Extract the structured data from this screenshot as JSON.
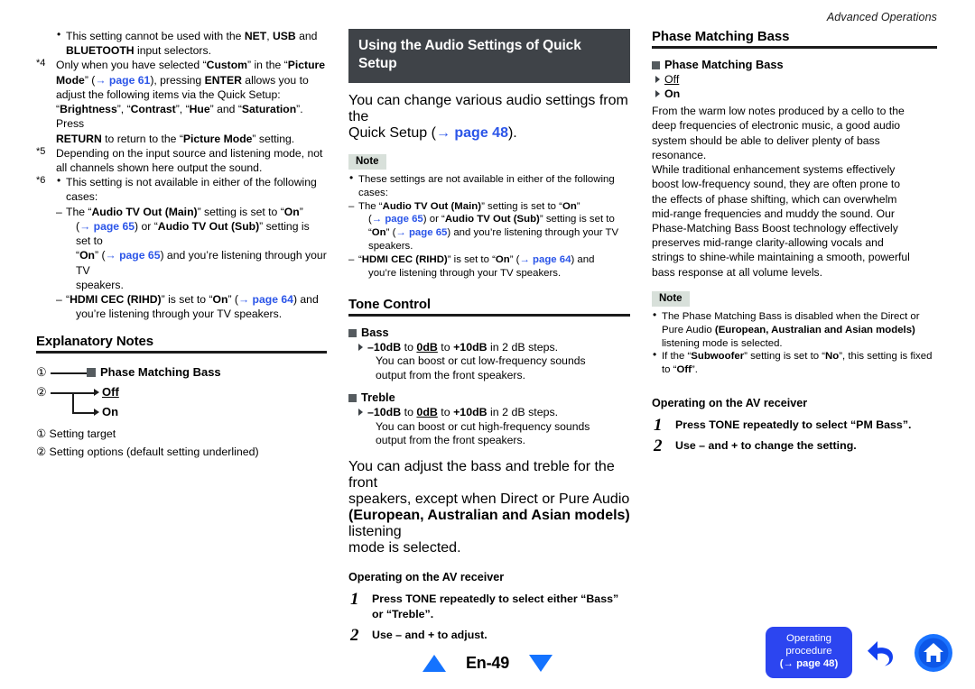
{
  "running_head": "Advanced Operations",
  "left_column": {
    "footnotes": [
      {
        "mark": "",
        "lines": [
          {
            "style": "bullet",
            "segments": [
              {
                "t": "This setting cannot be used with the ",
                "b": false
              },
              {
                "t": "NET",
                "b": true
              },
              {
                "t": ", ",
                "b": false
              },
              {
                "t": "USB",
                "b": true
              },
              {
                "t": " and",
                "b": false
              }
            ]
          },
          {
            "style": "cont1",
            "segments": [
              {
                "t": "BLUETOOTH",
                "b": true
              },
              {
                "t": " input selectors.",
                "b": false
              }
            ]
          }
        ]
      },
      {
        "mark": "*4",
        "lines": [
          {
            "style": "plain",
            "segments": [
              {
                "t": "Only when you have selected “",
                "b": false
              },
              {
                "t": "Custom",
                "b": true
              },
              {
                "t": "” in the “",
                "b": false
              },
              {
                "t": "Picture",
                "b": true
              }
            ]
          },
          {
            "style": "plain",
            "segments": [
              {
                "t": "Mode",
                "b": true
              },
              {
                "t": "” (",
                "b": false
              },
              {
                "t": "→ page 61",
                "link": true
              },
              {
                "t": "), pressing ",
                "b": false
              },
              {
                "t": "ENTER",
                "b": true
              },
              {
                "t": " allows you to",
                "b": false
              }
            ]
          },
          {
            "style": "plain",
            "segments": [
              {
                "t": "adjust the following items via the Quick Setup:",
                "b": false
              }
            ]
          },
          {
            "style": "plain",
            "segments": [
              {
                "t": "“",
                "b": false
              },
              {
                "t": "Brightness",
                "b": true
              },
              {
                "t": "”, “",
                "b": false
              },
              {
                "t": "Contrast",
                "b": true
              },
              {
                "t": "”, “",
                "b": false
              },
              {
                "t": "Hue",
                "b": true
              },
              {
                "t": "” and “",
                "b": false
              },
              {
                "t": "Saturation",
                "b": true
              },
              {
                "t": "”. Press",
                "b": false
              }
            ]
          },
          {
            "style": "plain",
            "segments": [
              {
                "t": "RETURN",
                "b": true
              },
              {
                "t": " to return to the “",
                "b": false
              },
              {
                "t": "Picture Mode",
                "b": true
              },
              {
                "t": "” setting.",
                "b": false
              }
            ]
          }
        ]
      },
      {
        "mark": "*5",
        "lines": [
          {
            "style": "plain",
            "segments": [
              {
                "t": "Depending on the input source and listening mode, not",
                "b": false
              }
            ]
          },
          {
            "style": "plain",
            "segments": [
              {
                "t": "all channels shown here output the sound.",
                "b": false
              }
            ]
          }
        ]
      },
      {
        "mark": "*6",
        "lines": [
          {
            "style": "bullet",
            "segments": [
              {
                "t": "This setting is not available in either of the following",
                "b": false
              }
            ]
          },
          {
            "style": "cont1",
            "segments": [
              {
                "t": "cases:",
                "b": false
              }
            ]
          },
          {
            "style": "dash",
            "segments": [
              {
                "t": "The “",
                "b": false
              },
              {
                "t": "Audio TV Out (Main)",
                "b": true
              },
              {
                "t": "” setting is set to “",
                "b": false
              },
              {
                "t": "On",
                "b": true
              },
              {
                "t": "”",
                "b": false
              }
            ]
          },
          {
            "style": "ind2",
            "segments": [
              {
                "t": "(",
                "b": false
              },
              {
                "t": "→ page 65",
                "link": true
              },
              {
                "t": ") or “",
                "b": false
              },
              {
                "t": "Audio TV Out (Sub)",
                "b": true
              },
              {
                "t": "” setting is set to",
                "b": false
              }
            ]
          },
          {
            "style": "ind2",
            "segments": [
              {
                "t": "“",
                "b": false
              },
              {
                "t": "On",
                "b": true
              },
              {
                "t": "” (",
                "b": false
              },
              {
                "t": "→ page 65",
                "link": true
              },
              {
                "t": ") and you’re listening through your TV",
                "b": false
              }
            ]
          },
          {
            "style": "ind2",
            "segments": [
              {
                "t": "speakers.",
                "b": false
              }
            ]
          },
          {
            "style": "dash",
            "segments": [
              {
                "t": "“",
                "b": false
              },
              {
                "t": "HDMI CEC (RIHD)",
                "b": true
              },
              {
                "t": "” is set to “",
                "b": false
              },
              {
                "t": "On",
                "b": true
              },
              {
                "t": "” (",
                "b": false
              },
              {
                "t": "→ page 64",
                "link": true
              },
              {
                "t": ") and",
                "b": false
              }
            ]
          },
          {
            "style": "ind2",
            "segments": [
              {
                "t": "you’re listening through your TV speakers.",
                "b": false
              }
            ]
          }
        ]
      }
    ],
    "explanatory": {
      "heading": "Explanatory Notes",
      "diagram": {
        "num1": "①",
        "num2": "②",
        "target_label": "Phase Matching Bass",
        "option1": "Off",
        "option2": "On"
      },
      "legend": [
        {
          "num": "①",
          "text": "Setting target"
        },
        {
          "num": "②",
          "text": "Setting options (default setting underlined)"
        }
      ]
    }
  },
  "mid_column": {
    "banner_title": "Using the Audio Settings of Quick Setup",
    "intro": [
      {
        "segments": [
          {
            "t": "You can change various audio settings from the",
            "b": false
          }
        ]
      },
      {
        "segments": [
          {
            "t": "Quick Setup (",
            "b": false
          },
          {
            "t": "→ page 48",
            "link": true
          },
          {
            "t": ").",
            "b": false
          }
        ]
      }
    ],
    "note_label": "Note",
    "note_lines": [
      {
        "style": "bullet",
        "segments": [
          {
            "t": "These settings are not available in either of the following",
            "b": false
          }
        ]
      },
      {
        "style": "cont1",
        "segments": [
          {
            "t": "cases:",
            "b": false
          }
        ]
      },
      {
        "style": "dash",
        "segments": [
          {
            "t": "The “",
            "b": false
          },
          {
            "t": "Audio TV Out (Main)",
            "b": true
          },
          {
            "t": "” setting is set to “",
            "b": false
          },
          {
            "t": "On",
            "b": true
          },
          {
            "t": "”",
            "b": false
          }
        ]
      },
      {
        "style": "ind2",
        "segments": [
          {
            "t": "(",
            "b": false
          },
          {
            "t": "→ page 65",
            "link": true
          },
          {
            "t": ") or “",
            "b": false
          },
          {
            "t": "Audio TV Out (Sub)",
            "b": true
          },
          {
            "t": "” setting is set to",
            "b": false
          }
        ]
      },
      {
        "style": "ind2",
        "segments": [
          {
            "t": "“",
            "b": false
          },
          {
            "t": "On",
            "b": true
          },
          {
            "t": "” (",
            "b": false
          },
          {
            "t": "→ page 65",
            "link": true
          },
          {
            "t": ") and you’re listening through your TV",
            "b": false
          }
        ]
      },
      {
        "style": "ind2",
        "segments": [
          {
            "t": "speakers.",
            "b": false
          }
        ]
      },
      {
        "style": "dash",
        "segments": [
          {
            "t": "“",
            "b": false
          },
          {
            "t": "HDMI CEC (RIHD)",
            "b": true
          },
          {
            "t": "” is set to “",
            "b": false
          },
          {
            "t": "On",
            "b": true
          },
          {
            "t": "” (",
            "b": false
          },
          {
            "t": "→ page 64",
            "link": true
          },
          {
            "t": ") and",
            "b": false
          }
        ]
      },
      {
        "style": "ind2",
        "segments": [
          {
            "t": "you’re listening through your TV speakers.",
            "b": false
          }
        ]
      }
    ],
    "tone_heading": "Tone Control",
    "items": [
      {
        "label": "Bass",
        "range_segments": [
          {
            "t": "–10dB",
            "b": true
          },
          {
            "t": " to ",
            "b": false
          },
          {
            "t": "0dB",
            "b": true,
            "u": true
          },
          {
            "t": " to ",
            "b": false
          },
          {
            "t": "+10dB",
            "b": true
          },
          {
            "t": " in 2 dB steps.",
            "b": false
          }
        ],
        "desc": [
          "You can boost or cut low-frequency sounds",
          "output from the front speakers."
        ]
      },
      {
        "label": "Treble",
        "range_segments": [
          {
            "t": "–10dB",
            "b": true
          },
          {
            "t": " to ",
            "b": false
          },
          {
            "t": "0dB",
            "b": true,
            "u": true
          },
          {
            "t": " to ",
            "b": false
          },
          {
            "t": "+10dB",
            "b": true
          },
          {
            "t": " in 2 dB steps.",
            "b": false
          }
        ],
        "desc": [
          "You can boost or cut high-frequency sounds",
          "output from the front speakers."
        ]
      }
    ],
    "body_lines": [
      {
        "segments": [
          {
            "t": "You can adjust the bass and treble for the front",
            "b": false
          }
        ]
      },
      {
        "segments": [
          {
            "t": "speakers, except when Direct or Pure Audio",
            "b": false
          }
        ]
      },
      {
        "segments": [
          {
            "t": "(European, Australian and Asian models)",
            "b": true
          },
          {
            "t": " listening",
            "b": false
          }
        ]
      },
      {
        "segments": [
          {
            "t": "mode is selected.",
            "b": false
          }
        ]
      }
    ],
    "operating_heading": "Operating on the AV receiver",
    "steps": [
      {
        "n": "1",
        "lines": [
          "Press TONE repeatedly to select either “Bass”",
          "or “Treble”."
        ]
      },
      {
        "n": "2",
        "lines": [
          "Use – and + to adjust."
        ]
      }
    ]
  },
  "right_column": {
    "heading": "Phase Matching Bass",
    "setting": {
      "label": "Phase Matching Bass",
      "option1": "Off",
      "option2": "On"
    },
    "paragraphs": [
      [
        "From the warm low notes produced by a cello to the",
        "deep frequencies of electronic music, a good audio",
        "system should be able to deliver plenty of bass",
        "resonance."
      ],
      [
        "While traditional enhancement systems effectively",
        "boost low-frequency sound, they are often prone to",
        "the effects of phase shifting, which can overwhelm",
        "mid-range frequencies and muddy the sound. Our",
        "Phase-Matching Bass Boost technology effectively",
        "preserves mid-range clarity-allowing vocals and",
        "strings to shine-while maintaining a smooth, powerful",
        "bass response at all volume levels."
      ]
    ],
    "note_label": "Note",
    "note_lines": [
      {
        "style": "bullet",
        "segments": [
          {
            "t": "The Phase Matching Bass is disabled when the Direct or",
            "b": false
          }
        ]
      },
      {
        "style": "cont1",
        "segments": [
          {
            "t": "Pure Audio ",
            "b": false
          },
          {
            "t": "(European, Australian and Asian models)",
            "b": true
          }
        ]
      },
      {
        "style": "cont1",
        "segments": [
          {
            "t": "listening mode is selected.",
            "b": false
          }
        ]
      },
      {
        "style": "bullet",
        "segments": [
          {
            "t": "If the “",
            "b": false
          },
          {
            "t": "Subwoofer",
            "b": true
          },
          {
            "t": "” setting is set to “",
            "b": false
          },
          {
            "t": "No",
            "b": true
          },
          {
            "t": "”, this setting is fixed",
            "b": false
          }
        ]
      },
      {
        "style": "cont1",
        "segments": [
          {
            "t": "to “",
            "b": false
          },
          {
            "t": "Off",
            "b": true
          },
          {
            "t": "”.",
            "b": false
          }
        ]
      }
    ],
    "operating_heading": "Operating on the AV receiver",
    "steps": [
      {
        "n": "1",
        "lines": [
          "Press TONE repeatedly to select “PM Bass”."
        ]
      },
      {
        "n": "2",
        "lines": [
          "Use – and + to change the setting."
        ]
      }
    ]
  },
  "footer": {
    "page_label": "En-49",
    "up_icon": "triangle-up-icon",
    "down_icon": "triangle-down-icon"
  },
  "nav": {
    "operating_button": {
      "line1": "Operating",
      "line2": "procedure",
      "line3": "(→ page 48)"
    },
    "back_icon": "back-arrow-icon",
    "home_icon": "home-icon"
  },
  "colors": {
    "banner_bg": "#3f4348",
    "link_blue": "#2b55e8",
    "note_bg": "#d8e0da",
    "nav_blue": "#2c45f0",
    "footer_triangle": "#1473ff",
    "square_marker": "#555b5f"
  }
}
